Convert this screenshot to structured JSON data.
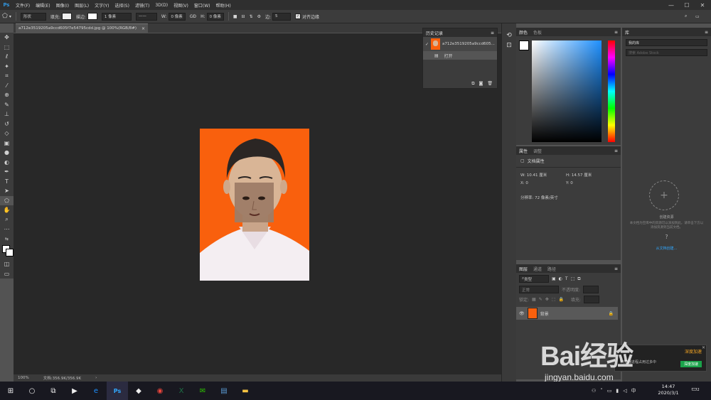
{
  "app": {
    "logo": "Ps"
  },
  "menu": [
    "文件(F)",
    "编辑(E)",
    "图像(I)",
    "图层(L)",
    "文字(Y)",
    "选择(S)",
    "滤镜(T)",
    "3D(D)",
    "视图(V)",
    "窗口(W)",
    "帮助(H)"
  ],
  "window_controls": {
    "minimize": "—",
    "maximize": "☐",
    "close": "✕"
  },
  "options": {
    "shape_mode": "形状",
    "fill_label": "填充:",
    "stroke_label": "描边:",
    "stroke_width": "1 像素",
    "w_label": "W:",
    "w_value": "0 像素",
    "link": "GĐ",
    "h_label": "H:",
    "h_value": "0 像素",
    "sides_label": "边:",
    "sides_value": "5",
    "align_edges": "对齐边缘"
  },
  "document": {
    "tab_title": "a712e3519205a9ccd605f7e54795cdd.jpg @ 100%(RGB/8#)",
    "tab_close": "×",
    "zoom": "100%",
    "doc_info": "文档:356.9K/356.9K",
    "status_arrow": "›"
  },
  "history": {
    "title": "历史记录",
    "snapshot_name": "a712e3519205a9ccd605...",
    "steps": [
      "打开"
    ]
  },
  "color_panel": {
    "tabs": [
      "颜色",
      "色板"
    ]
  },
  "properties_panel": {
    "tabs": [
      "属性",
      "调整"
    ],
    "section": "文档属性",
    "w_label": "W:",
    "w_value": "10.41 厘米",
    "h_label": "H:",
    "h_value": "14.57 厘米",
    "x_label": "X:",
    "x_value": "0",
    "y_label": "Y:",
    "y_value": "0",
    "resolution": "分辨率: 72 像素/英寸"
  },
  "layers_panel": {
    "tabs": [
      "图层",
      "通道",
      "路径"
    ],
    "kind_label": "类型",
    "blend_mode": "正常",
    "opacity_label": "不透明度:",
    "lock_label": "锁定:",
    "fill_label": "填充:",
    "layers": [
      {
        "name": "背景"
      }
    ]
  },
  "library_panel": {
    "tab": "库",
    "library_select": "我的库",
    "search_placeholder": "搜索 Adobe Stock",
    "add_label": "创建资源",
    "help_text": "本文档为空库中的资源可以添加到此，请单击下方以添加资源到当前文档。",
    "link_text": "从文档创建..."
  },
  "taskbar": {
    "time": "14:47",
    "date": "2020/3/1",
    "notification_count": "2"
  },
  "overlay": {
    "watermark_site": "jingyan.baidu.com",
    "watermark_brand": "Bai经验",
    "popup_text": "深度加速",
    "popup_sub": "浏览器进程占用过多中",
    "popup_button": "深度加速"
  },
  "colors": {
    "canvas_bg": "#282828",
    "panel_bg": "#3c3c3c",
    "photo_bg": "#f9600d",
    "accent_blue": "#31a8ff",
    "popup_green": "#1aa34a"
  }
}
